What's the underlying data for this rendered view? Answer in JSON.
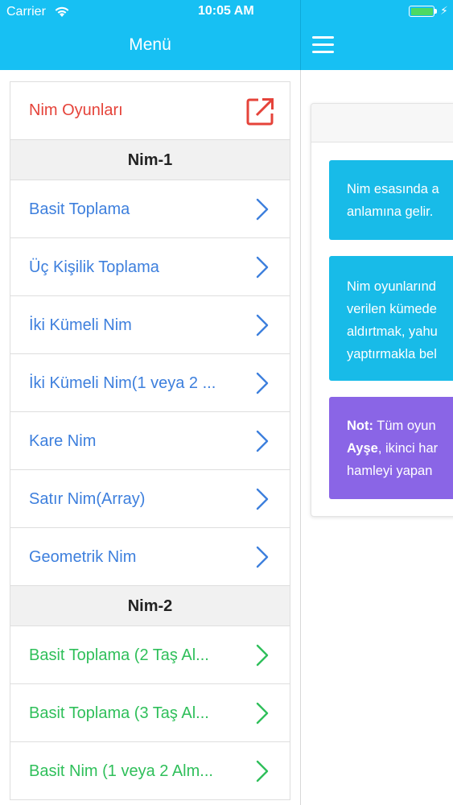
{
  "status_bar": {
    "carrier": "Carrier",
    "time": "10:05 AM",
    "battery_level": 1.0,
    "battery_color": "#4cd964"
  },
  "nav": {
    "title": "Menü",
    "menu_icon": "hamburger-icon",
    "color": "#17c0f3"
  },
  "menu": {
    "header": {
      "label": "Nim Oyunları",
      "icon": "external-link-icon",
      "color": "#e5433a"
    },
    "sections": [
      {
        "title": "Nim-1",
        "color": "#3d7fdd",
        "items": [
          {
            "label": "Basit Toplama"
          },
          {
            "label": "Üç Kişilik Toplama"
          },
          {
            "label": "İki Kümeli Nim"
          },
          {
            "label": "İki Kümeli Nim(1 veya 2 ..."
          },
          {
            "label": "Kare Nim"
          },
          {
            "label": "Satır Nim(Array)"
          },
          {
            "label": "Geometrik Nim"
          }
        ]
      },
      {
        "title": "Nim-2",
        "color": "#2fbf5a",
        "items": [
          {
            "label": "Basit Toplama (2 Taş Al..."
          },
          {
            "label": "Basit Toplama (3 Taş Al..."
          },
          {
            "label": "Basit Nim (1 veya 2 Alm..."
          }
        ]
      }
    ]
  },
  "detail": {
    "notes": [
      {
        "lines": [
          "Nim esasında a",
          "anlamına gelir."
        ],
        "color": "#18bbe8"
      },
      {
        "lines": [
          "Nim oyunlarınd",
          "verilen kümede",
          "aldırtmak, yahu",
          "yaptırmakla bel"
        ],
        "color": "#18bbe8"
      },
      {
        "bold_prefix": "Not:",
        "line1_rest": " Tüm oyun",
        "bold_line2": "Ayşe",
        "line2_rest": ", ikinci har",
        "line3": "hamleyi yapan",
        "color": "#8a65e6"
      }
    ]
  }
}
